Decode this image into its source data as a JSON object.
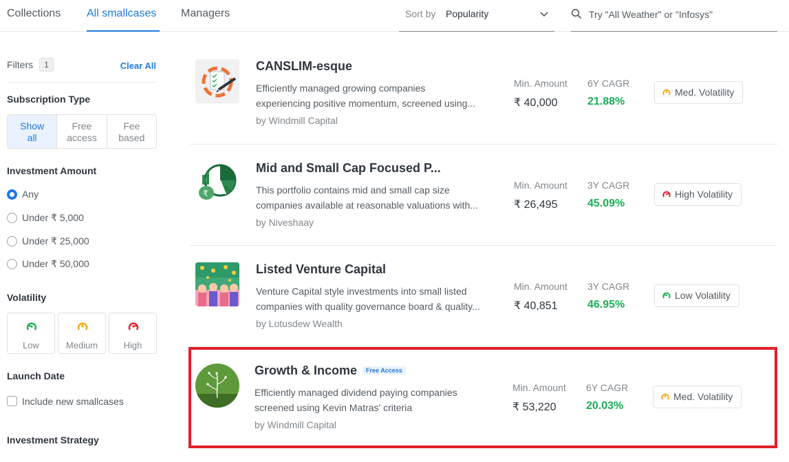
{
  "tabs": [
    {
      "label": "Collections"
    },
    {
      "label": "All smallcases"
    },
    {
      "label": "Managers"
    }
  ],
  "sort": {
    "label": "Sort by",
    "value": "Popularity"
  },
  "search": {
    "placeholder": "Try \"All Weather\" or \"Infosys\""
  },
  "filters": {
    "label": "Filters",
    "count": "1",
    "clear_label": "Clear All",
    "subscription": {
      "title": "Subscription Type",
      "options": [
        {
          "line1": "Show",
          "line2": "all"
        },
        {
          "line1": "Free",
          "line2": "access"
        },
        {
          "line1": "Fee",
          "line2": "based"
        }
      ]
    },
    "amount": {
      "title": "Investment Amount",
      "options": [
        "Any",
        "Under ₹ 5,000",
        "Under ₹ 25,000",
        "Under ₹ 50,000"
      ]
    },
    "volatility": {
      "title": "Volatility",
      "options": [
        "Low",
        "Medium",
        "High"
      ]
    },
    "launch": {
      "title": "Launch Date",
      "option": "Include new smallcases"
    },
    "strategy": {
      "title": "Investment Strategy"
    }
  },
  "colors": {
    "accent": "#1f7ae0",
    "positive": "#19af55",
    "low": "#19af55",
    "medium": "#f4a917",
    "high": "#e3202a",
    "highlight": "#e3202a"
  },
  "cards": [
    {
      "title": "CANSLIM-esque",
      "badge": "",
      "desc1": "Efficiently managed growing companies",
      "desc2": "experiencing positive momentum, screened using...",
      "manager": "by Windmill Capital",
      "min_label": "Min. Amount",
      "min_value": "₹ 40,000",
      "cagr_label": "6Y CAGR",
      "cagr_value": "21.88%",
      "volatility": "Med. Volatility",
      "icon": "checklist-pen-icon"
    },
    {
      "title": "Mid and Small Cap Focused P...",
      "badge": "",
      "desc1": "This portfolio contains mid and small cap size",
      "desc2": "companies available at reasonable valuations with...",
      "manager": "by Niveshaay",
      "min_label": "Min. Amount",
      "min_value": "₹ 26,495",
      "cagr_label": "3Y CAGR",
      "cagr_value": "45.09%",
      "volatility": "High Volatility",
      "icon": "pie-chart-money-icon"
    },
    {
      "title": "Listed Venture Capital",
      "badge": "",
      "desc1": "Venture Capital style investments into small listed",
      "desc2": "companies with quality governance board & quality...",
      "manager": "by Lotusdew Wealth",
      "min_label": "Min. Amount",
      "min_value": "₹ 40,851",
      "cagr_label": "3Y CAGR",
      "cagr_value": "46.95%",
      "volatility": "Low Volatility",
      "icon": "crowd-celebration-icon"
    },
    {
      "title": "Growth & Income",
      "badge": "Free Access",
      "desc1": "Efficiently managed dividend paying companies",
      "desc2": "screened using Kevin Matras' criteria",
      "manager": "by Windmill Capital",
      "min_label": "Min. Amount",
      "min_value": "₹ 53,220",
      "cagr_label": "6Y CAGR",
      "cagr_value": "20.03%",
      "volatility": "Med. Volatility",
      "icon": "plant-growth-icon"
    }
  ]
}
